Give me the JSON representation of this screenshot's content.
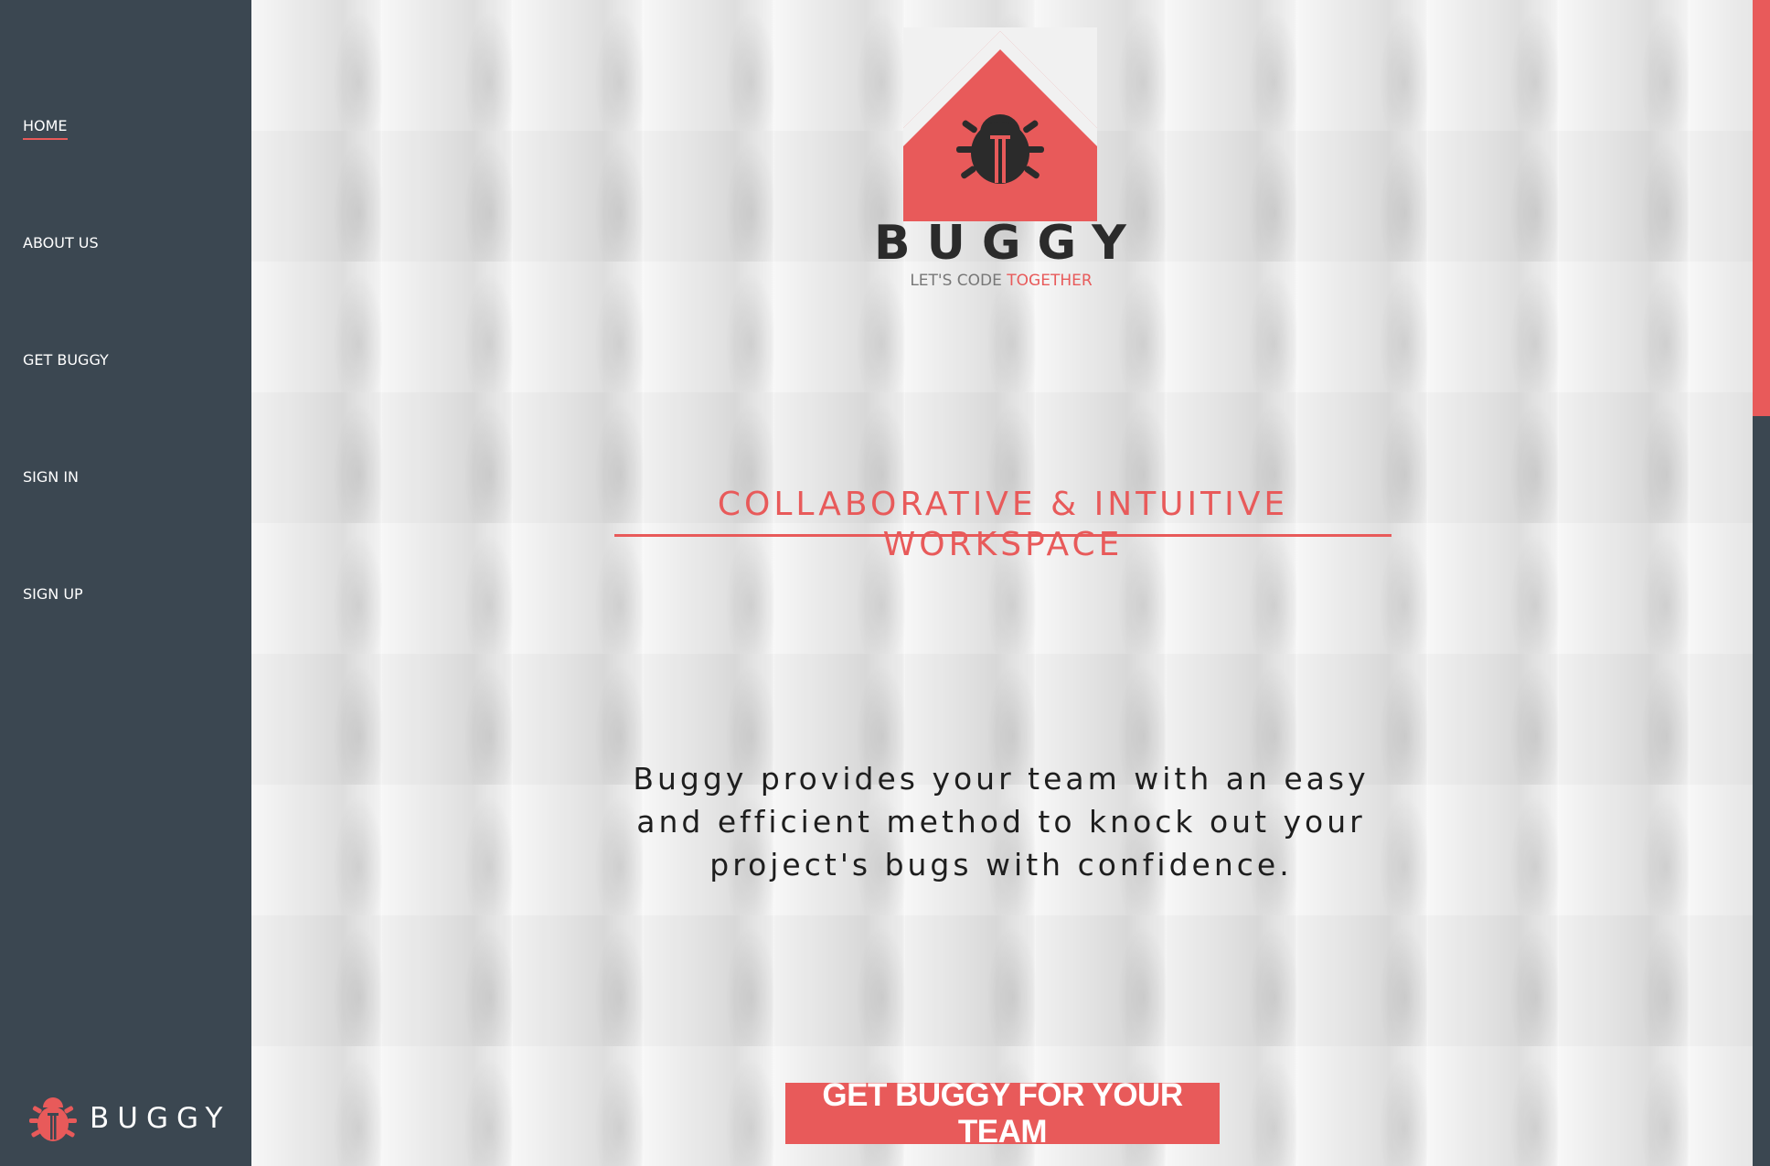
{
  "sidebar": {
    "items": [
      {
        "label": "HOME",
        "active": true
      },
      {
        "label": "ABOUT US",
        "active": false
      },
      {
        "label": "GET BUGGY",
        "active": false
      },
      {
        "label": "SIGN IN",
        "active": false
      },
      {
        "label": "SIGN UP",
        "active": false
      }
    ],
    "logo_text": "BUGGY",
    "logo_icon": "bug-icon"
  },
  "hero": {
    "logo_icon": "house-bug-icon",
    "brand_name": "BUGGY",
    "tagline_prefix": "LET'S CODE ",
    "tagline_accent": "TOGETHER",
    "headline": "COLLABORATIVE & INTUITIVE WORKSPACE",
    "description": "Buggy provides your team with an easy and efficient method to knock out your project's bugs with confidence.",
    "cta_label": "GET BUGGY FOR YOUR TEAM"
  },
  "colors": {
    "accent": "#e85a5a",
    "sidebar_bg": "#3b4751",
    "dark_text": "#2b2b2b"
  }
}
